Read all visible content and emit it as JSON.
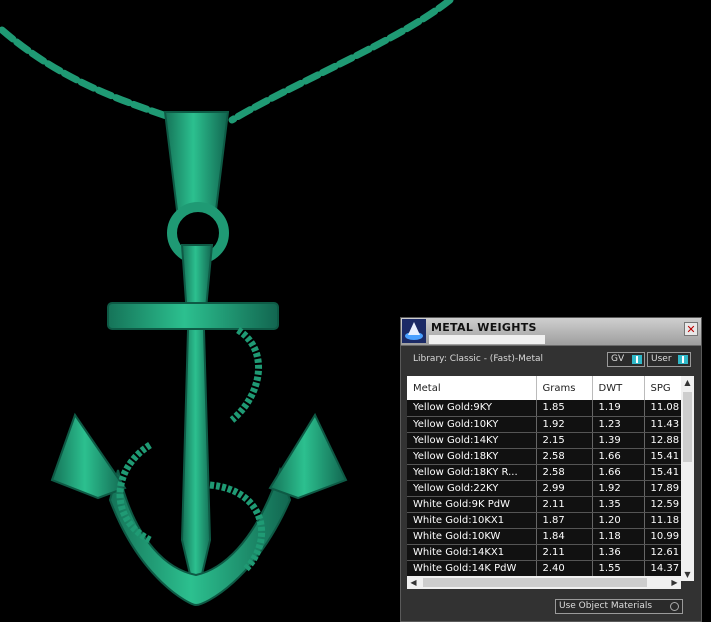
{
  "panel": {
    "title": "METAL WEIGHTS",
    "close_glyph": "✕",
    "library_text": "Library: Classic - (Fast)-Metal",
    "toggle_gv": "GV",
    "toggle_user": "User",
    "columns": [
      "Metal",
      "Grams",
      "DWT",
      "SPG"
    ],
    "rows": [
      [
        "Yellow Gold:9KY",
        "1.85",
        "1.19",
        "11.08"
      ],
      [
        "Yellow Gold:10KY",
        "1.92",
        "1.23",
        "11.43"
      ],
      [
        "Yellow Gold:14KY",
        "2.15",
        "1.39",
        "12.88"
      ],
      [
        "Yellow Gold:18KY",
        "2.58",
        "1.66",
        "15.41"
      ],
      [
        "Yellow Gold:18KY R...",
        "2.58",
        "1.66",
        "15.41"
      ],
      [
        "Yellow Gold:22KY",
        "2.99",
        "1.92",
        "17.89"
      ],
      [
        "White Gold:9K PdW",
        "2.11",
        "1.35",
        "12.59"
      ],
      [
        "White Gold:10KX1",
        "1.87",
        "1.20",
        "11.18"
      ],
      [
        "White Gold:10KW",
        "1.84",
        "1.18",
        "10.99"
      ],
      [
        "White Gold:14KX1",
        "2.11",
        "1.36",
        "12.61"
      ],
      [
        "White Gold:14K PdW",
        "2.40",
        "1.55",
        "14.37"
      ]
    ],
    "use_object_materials": "Use Object Materials",
    "scroll_up": "▲",
    "scroll_down": "▼",
    "scroll_left": "◀",
    "scroll_right": "▶"
  },
  "colors": {
    "model": "#22a07a",
    "toggle_accent": "#2fb8c8",
    "background": "#000000"
  },
  "icons": [
    "app-logo-icon",
    "close-icon",
    "anchor-pendant-model"
  ]
}
